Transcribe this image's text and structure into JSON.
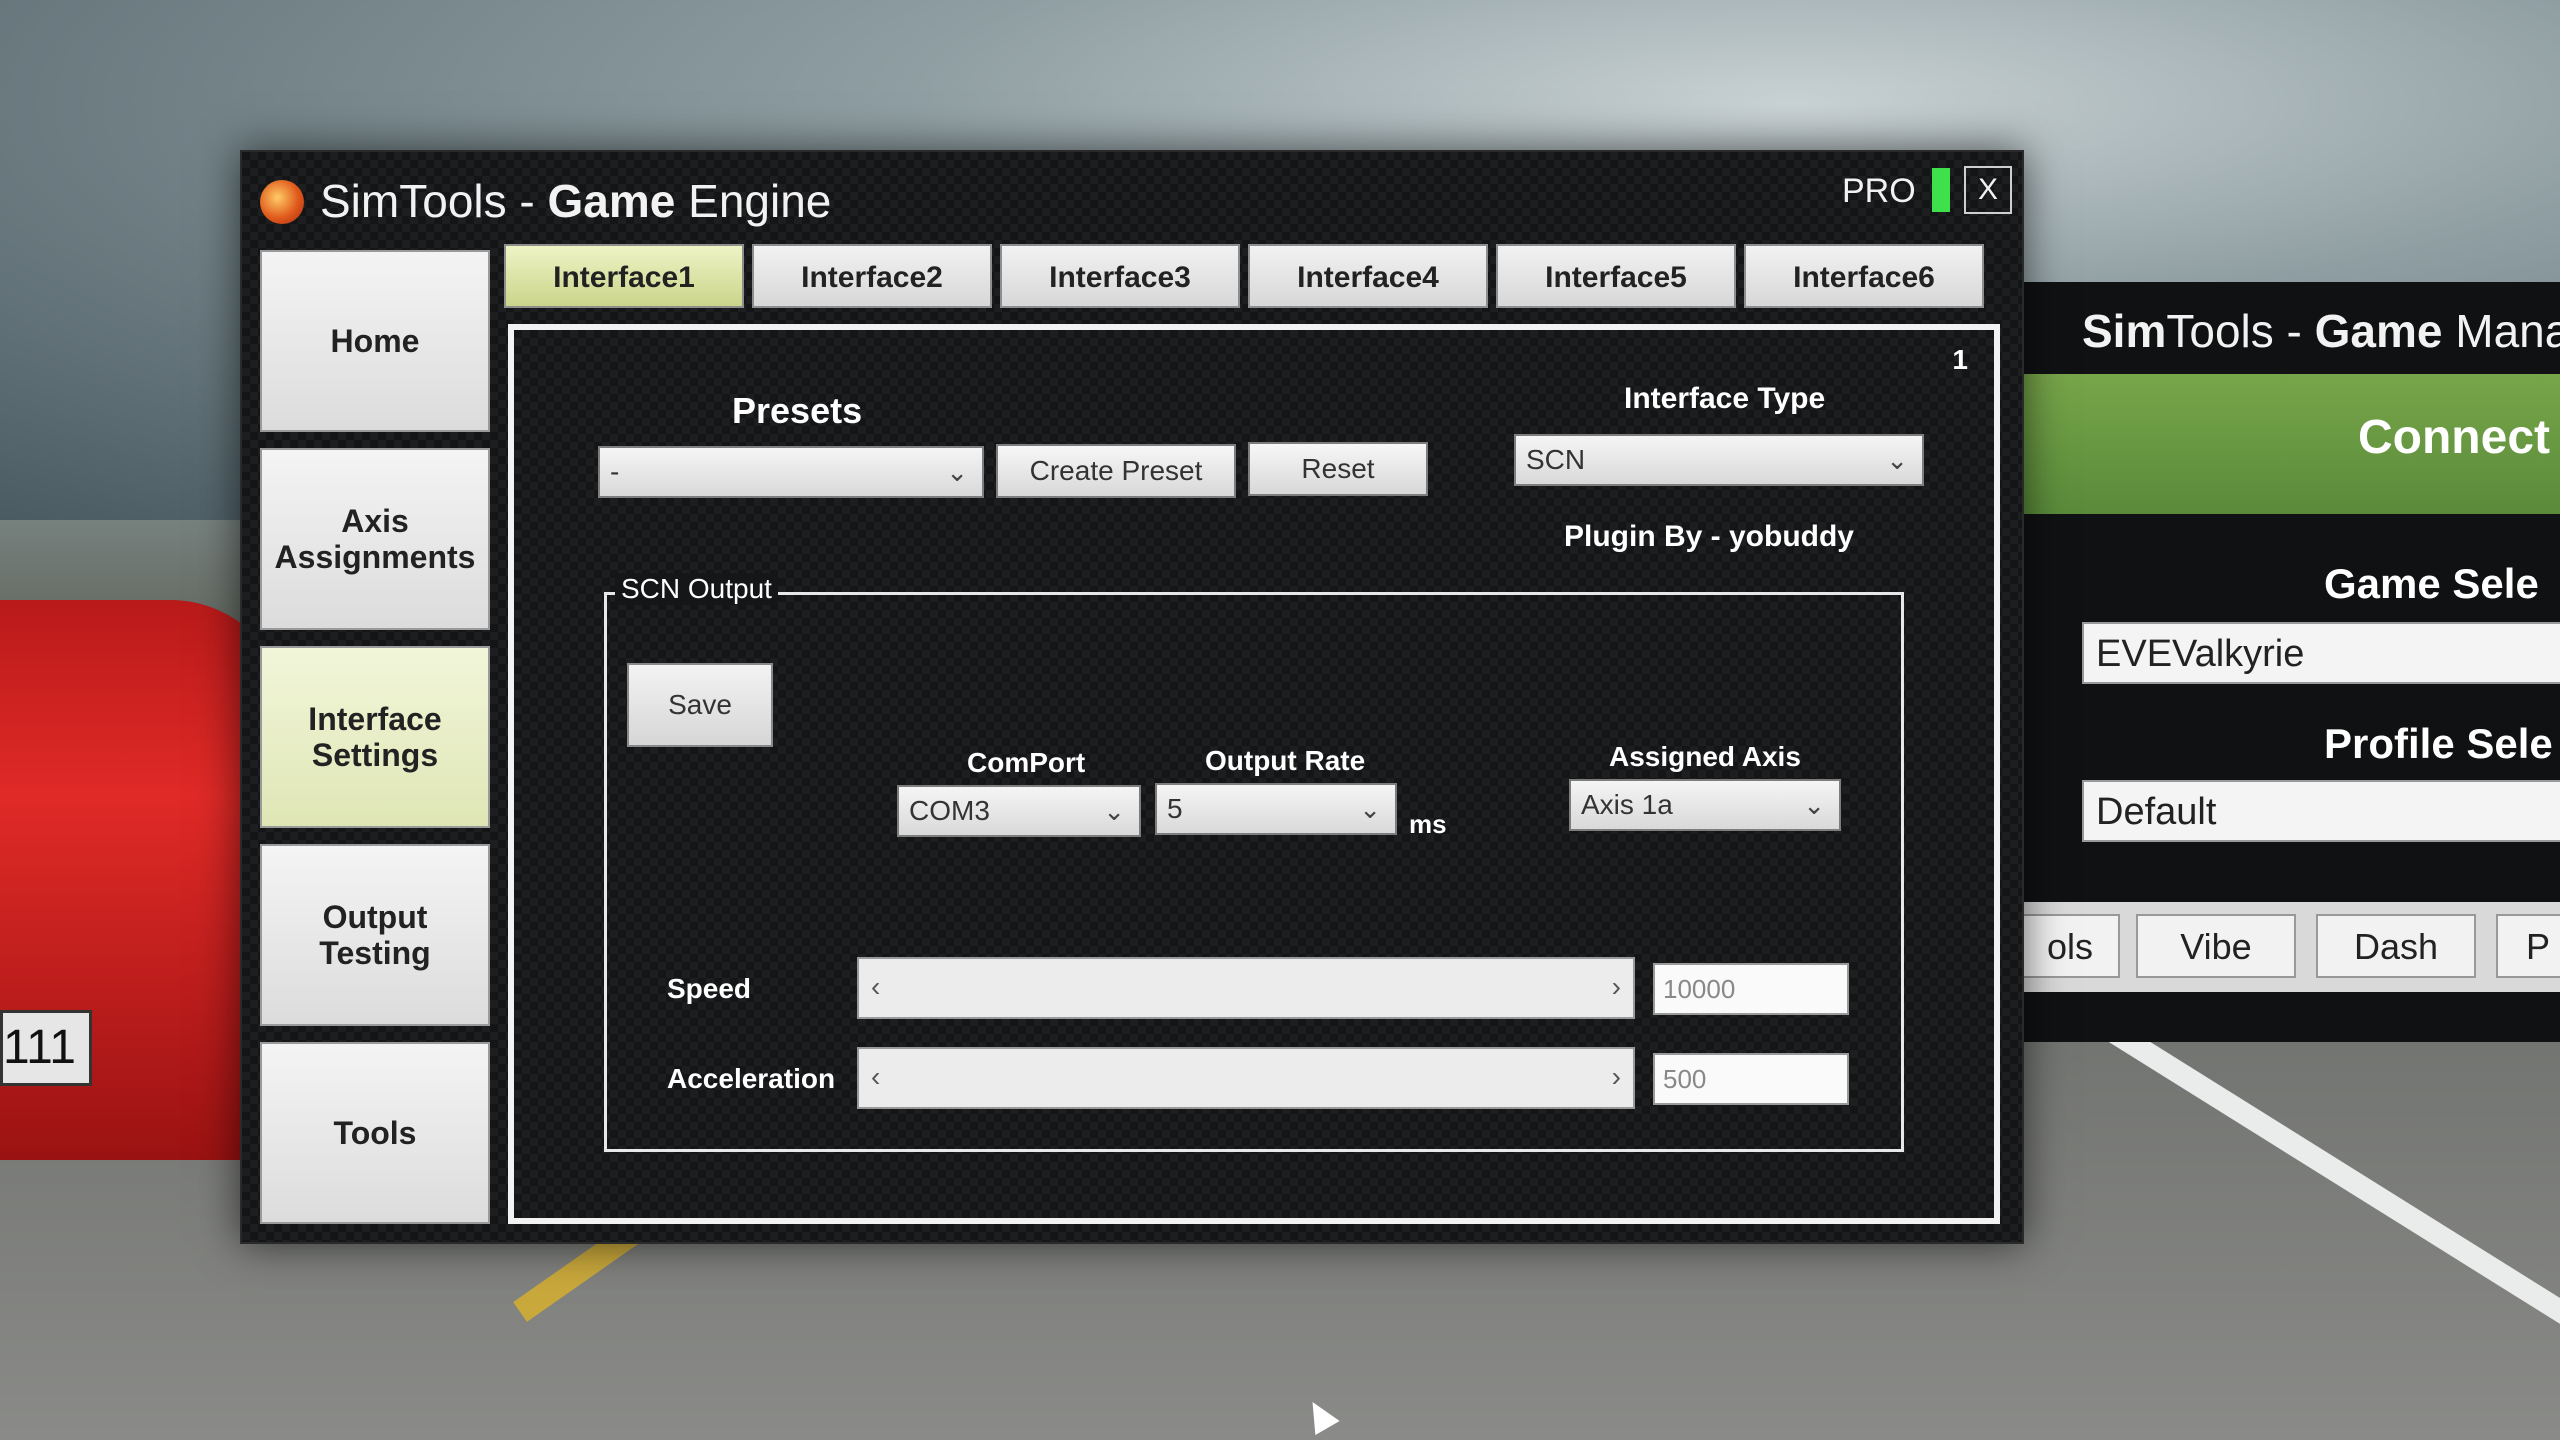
{
  "window": {
    "title_prefix": "Sim",
    "title_rest": "Tools - ",
    "title_bold": "Game",
    "title_tail": " Engine",
    "pro_label": "PRO",
    "close_label": "X"
  },
  "nav": {
    "items": [
      {
        "label": "Home"
      },
      {
        "label": "Axis Assignments"
      },
      {
        "label": "Interface Settings",
        "active": true
      },
      {
        "label": "Output Testing"
      },
      {
        "label": "Tools"
      }
    ]
  },
  "tabs": [
    "Interface1",
    "Interface2",
    "Interface3",
    "Interface4",
    "Interface5",
    "Interface6"
  ],
  "panel": {
    "number": "1",
    "presets_label": "Presets",
    "presets_value": "-",
    "create_preset": "Create Preset",
    "reset": "Reset",
    "interface_type_label": "Interface Type",
    "interface_type_value": "SCN",
    "plugin_by": "Plugin By - yobuddy"
  },
  "scn": {
    "group_title": "SCN Output",
    "save": "Save",
    "comport_label": "ComPort",
    "comport_value": "COM3",
    "output_rate_label": "Output Rate",
    "output_rate_value": "5",
    "ms_label": "ms",
    "assigned_axis_label": "Assigned Axis",
    "assigned_axis_value": "Axis 1a",
    "speed_label": "Speed",
    "speed_value": "10000",
    "acceleration_label": "Acceleration",
    "acceleration_value": "500"
  },
  "manager": {
    "title_bold1": "Sim",
    "title_rest": "Tools - ",
    "title_bold2": "Game",
    "title_tail": " Mana",
    "connect": "Connect",
    "game_select_label": "Game Sele",
    "game_value": "EVEValkyrie",
    "profile_select_label": "Profile Sele",
    "profile_value": "Default",
    "tabs": [
      "ols",
      "Vibe",
      "Dash",
      "P"
    ]
  },
  "plate": "111",
  "colors": {
    "active_tab": "#cbd58a",
    "pro_bar": "#3ee04b",
    "connect_bg": "#5a8b3a"
  }
}
